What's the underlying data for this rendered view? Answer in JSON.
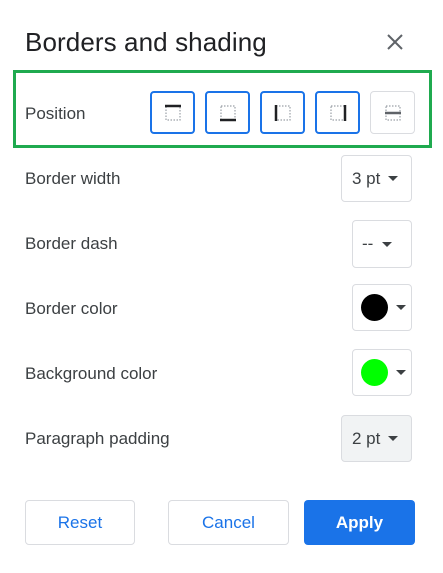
{
  "dialog": {
    "title": "Borders and shading"
  },
  "position": {
    "label": "Position",
    "buttons": [
      {
        "name": "border-top-icon",
        "selected": true
      },
      {
        "name": "border-bottom-icon",
        "selected": true
      },
      {
        "name": "border-left-icon",
        "selected": true
      },
      {
        "name": "border-right-icon",
        "selected": true
      },
      {
        "name": "border-between-icon",
        "selected": false
      }
    ]
  },
  "border_width": {
    "label": "Border width",
    "value": "3 pt"
  },
  "border_dash": {
    "label": "Border dash",
    "value": "--"
  },
  "border_color": {
    "label": "Border color",
    "color": "#000000"
  },
  "background_color": {
    "label": "Background color",
    "color": "#00ff00"
  },
  "paragraph_padding": {
    "label": "Paragraph padding",
    "value": "2 pt"
  },
  "footer": {
    "reset_label": "Reset",
    "cancel_label": "Cancel",
    "apply_label": "Apply"
  },
  "colors": {
    "accent": "#1a73e8",
    "highlight": "#1faa4f"
  }
}
